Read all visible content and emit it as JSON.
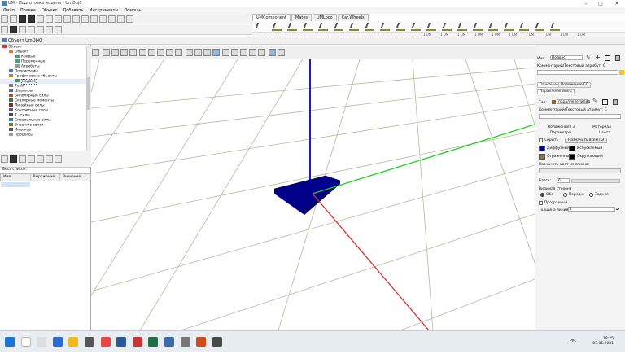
{
  "window": {
    "title": "UM - Подготовка модели - UmObj0",
    "minimize_icon": "–",
    "maximize_icon": "□",
    "close_icon": "✕"
  },
  "menu": [
    "Файл",
    "Правка",
    "Объект",
    "Добавить",
    "Инструменты",
    "Помощь"
  ],
  "upper_tabs": [
    "UMComponent",
    "Mates",
    "UMLoco",
    "Car.Wheels"
  ],
  "upper_tool_labels": [
    "1 Normal",
    "1 UM G.L.",
    "1 UM G.L.",
    "1 UM G.L.",
    "1 UM G.L.",
    "1 UM G.P.",
    "1 UM G.P.",
    "1 UM G.P.",
    "1 UM G.P.",
    "1 UM G.P.",
    "1 UM Stab.",
    "1 UM Stab.",
    "1 UM Stab.",
    "1 UM Stab.",
    "1 UM Stab.",
    "1 UM Stab.",
    "1 UM Stab.",
    "1 UM Stab.",
    "1 UM Stab.",
    "1 UM Stab."
  ],
  "main_header": {
    "title": "Объект UmObj0"
  },
  "tree": {
    "items": [
      {
        "label": "Объект",
        "indent": 0
      },
      {
        "label": "Объект",
        "indent": 1
      },
      {
        "label": "Кривые",
        "indent": 2
      },
      {
        "label": "Переменные",
        "indent": 2
      },
      {
        "label": "Атрибуты",
        "indent": 2
      },
      {
        "label": "Подсистемы",
        "indent": 1
      },
      {
        "label": "Графические объекты",
        "indent": 1
      },
      {
        "label": "Подвес",
        "indent": 2,
        "selected": true
      },
      {
        "label": "Тела",
        "indent": 1
      },
      {
        "label": "Шарниры",
        "indent": 1
      },
      {
        "label": "Биполярные силы",
        "indent": 1
      },
      {
        "label": "Скалярные моменты",
        "indent": 1
      },
      {
        "label": "Линейные силы",
        "indent": 1
      },
      {
        "label": "Контактные силы",
        "indent": 1
      },
      {
        "label": "Т - силы",
        "indent": 1
      },
      {
        "label": "Специальные силы",
        "indent": 1
      },
      {
        "label": "Внешние связи",
        "indent": 1
      },
      {
        "label": "Индексы",
        "indent": 1
      },
      {
        "label": "Процессы",
        "indent": 1
      }
    ]
  },
  "var_panel": {
    "list_label": "Весь список:",
    "columns": [
      "Имя",
      "Выражение",
      "Значение"
    ]
  },
  "right": {
    "name_label": "Имя:",
    "name_value": "Подвес",
    "comment_label": "Комментарий/Текстовый атрибут: С",
    "tabs": [
      "Описание",
      "Положение ГО"
    ],
    "sub_tab": "Параллелепипед",
    "type_label": "Тип:",
    "type_value": "параллелепипед",
    "comment2_label": "Комментарий/Текстовый атрибут: С",
    "subtabs2": [
      "Положение ГЭ",
      "Материал"
    ],
    "subtabs3": [
      "Параметры",
      "Цвета"
    ],
    "hidden_label": "Скрыть",
    "assign_all_button": "Назначить всем ГЭ",
    "colors": [
      {
        "label": "Диффузный",
        "color": "#00008b"
      },
      {
        "label": "Испускаемый",
        "color": "#000000"
      },
      {
        "label": "Отраженный",
        "color": "#8b7355"
      },
      {
        "label": "Окружающий",
        "color": "#000000"
      }
    ],
    "assign_from_list_label": "Назначить цвет из списка:",
    "gloss_label": "Блеск:",
    "gloss_value": "6",
    "visible_side_label": "Видимая сторона",
    "sides": [
      "Обе",
      "Передн.",
      "Задняя"
    ],
    "transparent_label": "Прозрачный",
    "line_width_label": "Толщина линий:",
    "line_width_value": "1"
  },
  "taskbar": {
    "lang": "РУС",
    "time": "18:25",
    "date": "03.05.2021"
  },
  "scene_colors": {
    "x_axis": "#d63030",
    "y_axis": "#22cc22",
    "z_axis": "#1a1ad6",
    "plate": "#00008b",
    "grid": "#b8b8a0"
  }
}
